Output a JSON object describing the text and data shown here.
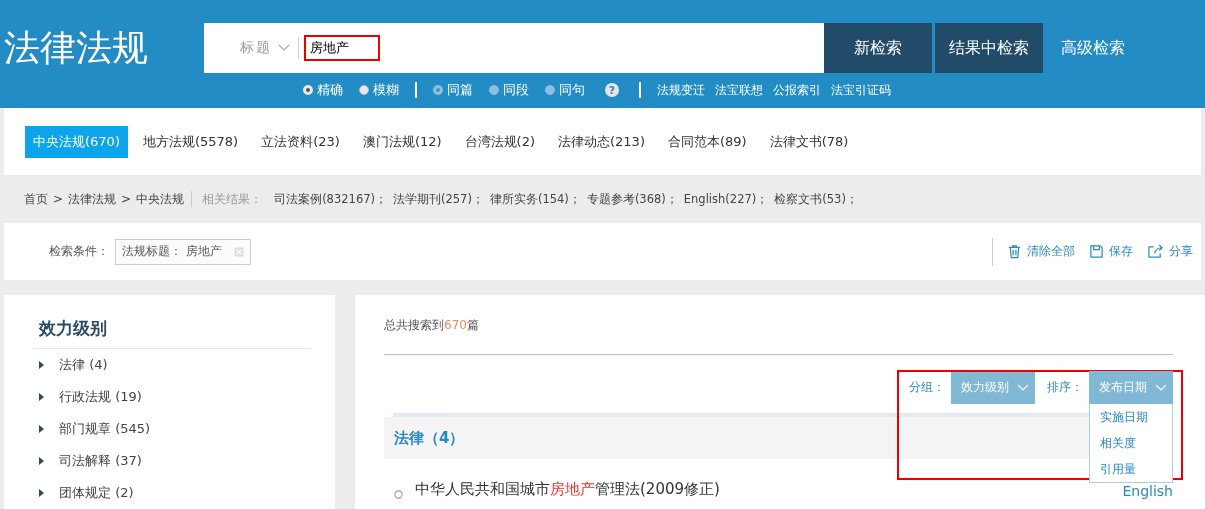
{
  "header": {
    "logo": "法律法规",
    "search": {
      "field_label": "标题",
      "query": "房地产",
      "highlighted": true
    },
    "buttons": [
      {
        "label": "新检索",
        "kind": "solid"
      },
      {
        "label": "结果中检索",
        "kind": "solid"
      },
      {
        "label": "高级检索",
        "kind": "plain"
      }
    ],
    "match_options": [
      {
        "label": "精确",
        "selected": true,
        "disabled": false
      },
      {
        "label": "模糊",
        "selected": false,
        "disabled": false
      }
    ],
    "scope_options": [
      {
        "label": "同篇",
        "selected": true,
        "disabled": true
      },
      {
        "label": "同段",
        "selected": false,
        "disabled": true
      },
      {
        "label": "同句",
        "selected": false,
        "disabled": true
      }
    ],
    "help": "?",
    "links": [
      "法规变迁",
      "法宝联想",
      "公报索引",
      "法宝引证码"
    ]
  },
  "tabs": [
    {
      "label": "中央法规(670)",
      "selected": true
    },
    {
      "label": "地方法规(5578)",
      "selected": false
    },
    {
      "label": "立法资料(23)",
      "selected": false
    },
    {
      "label": "澳门法规(12)",
      "selected": false
    },
    {
      "label": "台湾法规(2)",
      "selected": false
    },
    {
      "label": "法律动态(213)",
      "selected": false
    },
    {
      "label": "合同范本(89)",
      "selected": false
    },
    {
      "label": "法律文书(78)",
      "selected": false
    }
  ],
  "breadcrumb": [
    "首页",
    "法律法规",
    "中央法规"
  ],
  "breadcrumb_separator": ">",
  "related": {
    "label": "相关结果：",
    "items": [
      "司法案例(832167)；",
      "法学期刊(257)；",
      "律所实务(154)；",
      "专题参考(368)；",
      "English(227)；",
      "检察文书(53)；"
    ]
  },
  "conditions": {
    "label": "检索条件：",
    "tags": [
      "法规标题： 房地产"
    ],
    "actions": [
      {
        "label": "清除全部",
        "kind": "trash"
      },
      {
        "label": "保存",
        "kind": "save"
      },
      {
        "label": "分享",
        "kind": "share"
      }
    ]
  },
  "sidebar": {
    "title": "效力级别",
    "items": [
      "法律 (4)",
      "行政法规 (19)",
      "部门规章 (545)",
      "司法解释 (37)",
      "团体规定 (2)"
    ]
  },
  "results": {
    "summary_prefix": "总共搜索到",
    "summary_count": "670",
    "summary_suffix": "篇",
    "toolbar": {
      "highlighted": true,
      "group_label": "分组：",
      "group_value": "效力级别",
      "sort_label": "排序：",
      "sort_value": "发布日期",
      "sort_menu": {
        "expanded": true,
        "options": [
          "实施日期",
          "相关度",
          "引用量"
        ]
      }
    },
    "group_title": "法律（4）",
    "items": [
      {
        "title_parts": [
          {
            "text": "中华人民共和国城市",
            "hit": false
          },
          {
            "text": "房地产",
            "hit": true
          },
          {
            "text": "管理法(2009修正)",
            "hit": false
          }
        ],
        "link": "English"
      }
    ]
  }
}
